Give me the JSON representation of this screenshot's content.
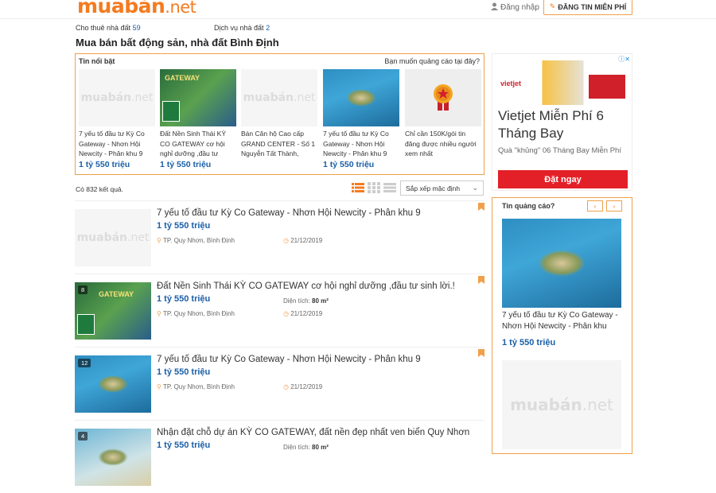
{
  "header": {
    "logo_main": "muabán",
    "logo_tld": ".net",
    "login": "Đăng nhập",
    "post_button": "ĐĂNG TIN MIỄN PHÍ"
  },
  "subnav": [
    {
      "label": "Cho thuê nhà đất",
      "count": "59"
    },
    {
      "label": "Dịch vụ nhà đất",
      "count": "2"
    }
  ],
  "page_title": "Mua bán bất động sản, nhà đất Bình Định",
  "featured": {
    "heading": "Tin nổi bật",
    "ad_question": "Bạn muốn quảng cáo tại đây?",
    "items": [
      {
        "title": "7 yếu tố đầu tư Kỳ Co Gateway - Nhơn Hội Newcity - Phân khu 9",
        "price": "1 tỷ 550 triệu",
        "image": "placeholder"
      },
      {
        "title": "Đất Nền Sinh Thái KỲ CO GATEWAY cơ hội nghỉ dưỡng ,đầu tư",
        "price": "1 tỷ 550 triệu",
        "image": "gateway"
      },
      {
        "title": "Bán Căn hộ Cao cấp GRAND CENTER - Số 1 Nguyễn Tất Thành,",
        "price": "",
        "image": "placeholder"
      },
      {
        "title": "7 yếu tố đầu tư Kỳ Co Gateway - Nhơn Hội Newcity - Phân khu 9",
        "price": "1 tỷ 550 triệu",
        "image": "sea"
      },
      {
        "title": "Chỉ cần 150K/gói tin đăng được nhiều người xem nhất",
        "price": "",
        "image": "star"
      }
    ]
  },
  "results": {
    "count_text": "Có 832 kết quả.",
    "sort_label": "Sắp xếp mặc định"
  },
  "listings": [
    {
      "title": "7 yếu tố đầu tư Kỳ Co Gateway - Nhơn Hội Newcity - Phân khu 9",
      "price": "1 tỷ 550 triệu",
      "area_label": "",
      "area_value": "",
      "location": "TP. Quy Nhơn, Bình Định",
      "date": "21/12/2019",
      "photos": "",
      "image": "placeholder"
    },
    {
      "title": "Đất Nền Sinh Thái KỲ CO GATEWAY cơ hội nghỉ dưỡng ,đầu tư sinh lời.!",
      "price": "1 tỷ 550 triệu",
      "area_label": "Diện tích:",
      "area_value": "80 m²",
      "location": "TP. Quy Nhơn, Bình Định",
      "date": "21/12/2019",
      "photos": "8",
      "image": "gateway"
    },
    {
      "title": "7 yếu tố đầu tư Kỳ Co Gateway - Nhơn Hội Newcity - Phân khu 9",
      "price": "1 tỷ 550 triệu",
      "area_label": "",
      "area_value": "",
      "location": "TP. Quy Nhơn, Bình Định",
      "date": "21/12/2019",
      "photos": "12",
      "image": "sea"
    },
    {
      "title": "Nhận đặt chỗ dự án KỲ CO GATEWAY, đất nền đẹp nhất ven biển Quy Nhơn",
      "price": "1 tỷ 550 triệu",
      "area_label": "Diện tích:",
      "area_value": "80 m²",
      "location": "",
      "date": "",
      "photos": "4",
      "image": "sea"
    }
  ],
  "ad": {
    "brand": "vietjet",
    "headline": "Vietjet Miễn Phí 6 Tháng Bay",
    "sub": "Quà \"khủng\" 06 Tháng Bay Miễn Phí",
    "cta": "Đặt ngay"
  },
  "sidebar": {
    "heading": "Tin quảng cáo?",
    "item_title": "7 yếu tố đầu tư Kỳ Co Gateway - Nhơn Hội Newcity - Phân khu",
    "item_price": "1 tỷ 550 triệu"
  },
  "colors": {
    "accent": "#f47b20",
    "price": "#1a5fa8",
    "cta": "#e32027"
  }
}
